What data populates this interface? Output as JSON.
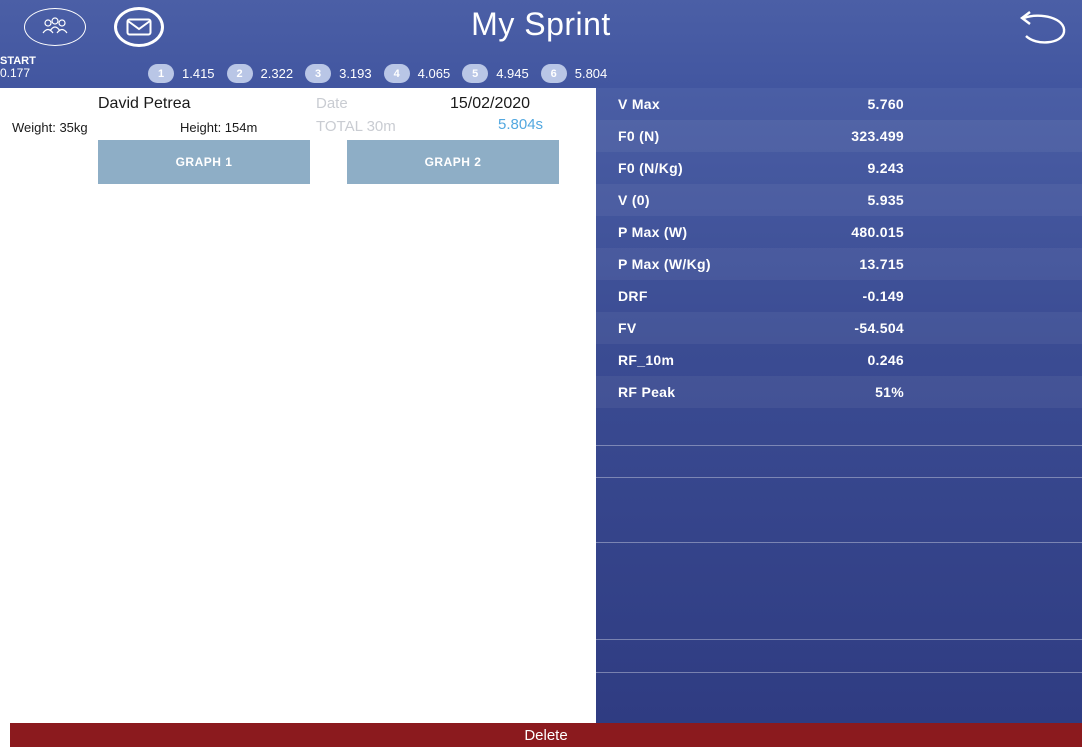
{
  "header": {
    "title": "My Sprint",
    "icons": {
      "team": "team-icon",
      "mail": "mail-icon",
      "back": "back-icon"
    }
  },
  "start": {
    "label": "START",
    "value": "0.177"
  },
  "splits": [
    {
      "num": "1",
      "value": "1.415"
    },
    {
      "num": "2",
      "value": "2.322"
    },
    {
      "num": "3",
      "value": "3.193"
    },
    {
      "num": "4",
      "value": "4.065"
    },
    {
      "num": "5",
      "value": "4.945"
    },
    {
      "num": "6",
      "value": "5.804"
    }
  ],
  "athlete": {
    "name": "David Petrea",
    "date_label": "Date",
    "date": "15/02/2020",
    "weight": "Weight: 35kg",
    "height": "Height: 154m",
    "total_label": "TOTAL 30m",
    "total_time": "5.804s"
  },
  "buttons": {
    "graph1": "GRAPH 1",
    "graph2": "GRAPH 2",
    "delete": "Delete"
  },
  "metrics": [
    {
      "label": "V Max",
      "value": "5.760"
    },
    {
      "label": "F0 (N)",
      "value": "323.499"
    },
    {
      "label": "F0 (N/Kg)",
      "value": "9.243"
    },
    {
      "label": "V (0)",
      "value": "5.935"
    },
    {
      "label": "P Max (W)",
      "value": "480.015"
    },
    {
      "label": "P Max (W/Kg)",
      "value": "13.715"
    },
    {
      "label": "DRF",
      "value": "-0.149"
    },
    {
      "label": "FV",
      "value": "-54.504"
    },
    {
      "label": "RF_10m",
      "value": "0.246"
    },
    {
      "label": "RF Peak",
      "value": "51%"
    }
  ],
  "colors": {
    "header_bg": "#4b5fa6",
    "panel_bg": "#3b4c93",
    "graph_button": "#8eaec6",
    "delete_bar": "#8b1a1e",
    "accent_time": "#53a8e0"
  }
}
